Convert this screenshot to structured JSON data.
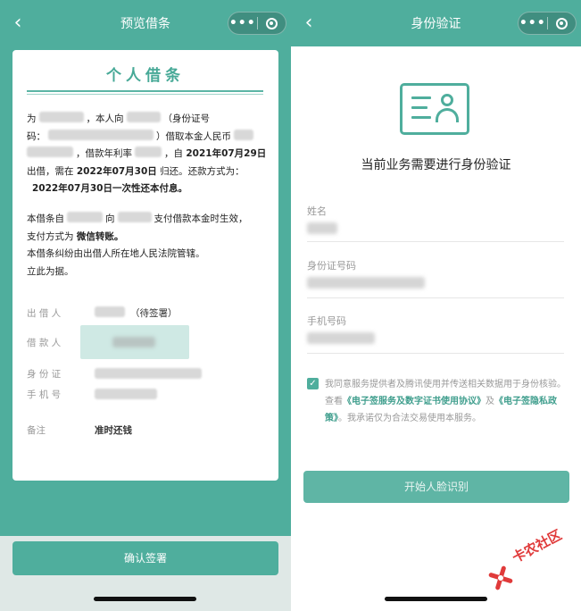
{
  "left": {
    "nav_title": "预览借条",
    "back_glyph": "‹",
    "capsule_dots": "•••",
    "card": {
      "title": "个人借条",
      "p1_a": "为",
      "p1_b": "，本人向",
      "p1_c": "（身份证号",
      "p1_d": "码：",
      "p1_e": "）借取本金人民币",
      "p1_f": "，借款年利率",
      "p1_g": "，自",
      "p1_start_date": "2021年07月29日",
      "p1_h": "出借，需在",
      "p1_due_date": "2022年07月30日",
      "p1_i": "归还。还款方式为：",
      "p1_repay": "2022年07月30日一次性还本付息。",
      "p2_a": "本借条自",
      "p2_b": "向",
      "p2_c": "支付借款本金时生效，",
      "p2_d": "支付方式为",
      "p2_pay_method": "微信转账。",
      "p2_e": "本借条纠纷由出借人所在地人民法院管辖。",
      "p2_f": "立此为据。",
      "lender_label": "出 借 人",
      "lender_status": "（待签署）",
      "borrower_label": "借 款 人",
      "id_label": "身 份 证",
      "phone_label": "手 机 号",
      "memo_label": "备注",
      "memo_value": "准时还钱"
    },
    "confirm_button": "确认签署"
  },
  "right": {
    "nav_title": "身份验证",
    "back_glyph": "‹",
    "capsule_dots": "•••",
    "verify_title": "当前业务需要进行身份验证",
    "name_label": "姓名",
    "id_label": "身份证号码",
    "phone_label": "手机号码",
    "checkbox_glyph": "✓",
    "agree_a": "我同意服务提供者及腾讯使用并传送相关数据用于身份核验。查看",
    "agree_link1": "《电子签服务及数字证书使用协议》",
    "agree_b": "及",
    "agree_link2": "《电子签隐私政策》",
    "agree_c": "。我承诺仅为合法交易使用本服务。",
    "start_button": "开始人脸识别"
  },
  "watermark": {
    "text": "卡农社区"
  },
  "colors": {
    "accent": "#4fae9d",
    "link": "#3f9e8d",
    "watermark": "#e03a3a"
  }
}
